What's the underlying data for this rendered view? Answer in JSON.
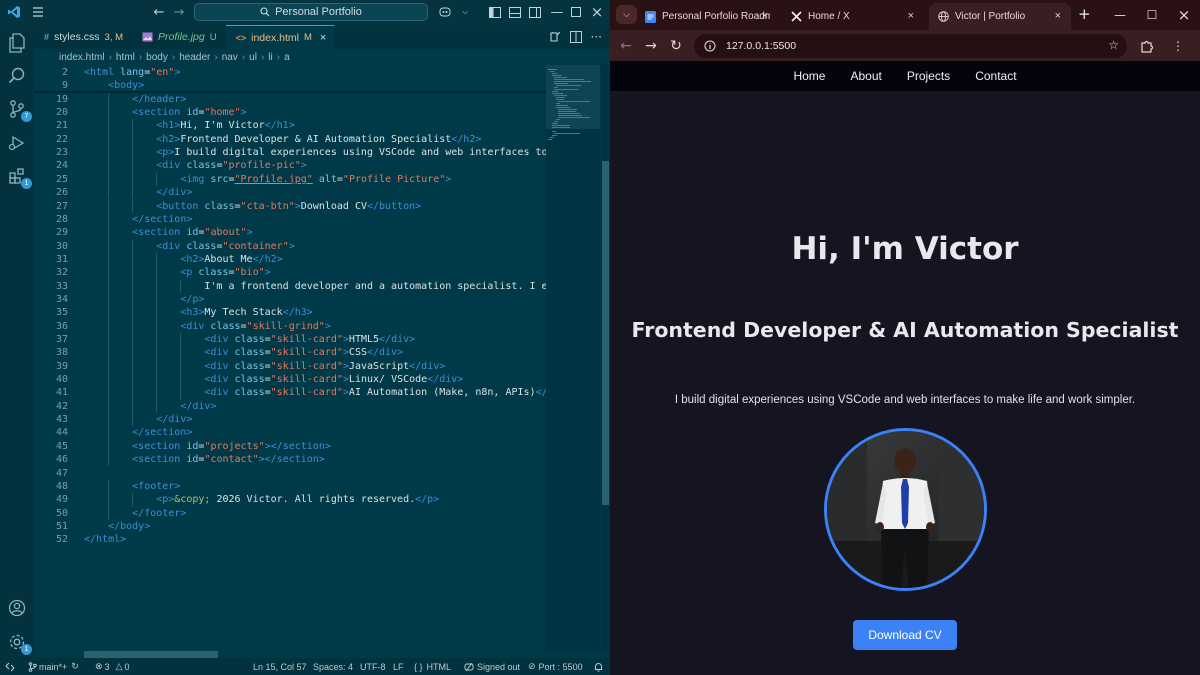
{
  "vscode": {
    "search_title": "Personal Portfolio",
    "tabs": [
      {
        "icon": "#",
        "name": "styles.css",
        "status": "3, M",
        "icon_color": "#42a5f5",
        "active": false,
        "italic": false
      },
      {
        "icon": "",
        "name": "Profile.jpg",
        "status": "U",
        "icon_color": "#a57bd1",
        "active": false,
        "italic": true
      },
      {
        "icon": "<>",
        "name": "index.html",
        "status": "M",
        "icon_color": "#e7824e",
        "active": true,
        "italic": false
      }
    ],
    "breadcrumb": [
      "index.html",
      "html",
      "body",
      "header",
      "nav",
      "ul",
      "li",
      "a"
    ],
    "activity_badges": {
      "source_control": "7",
      "extensions": "1",
      "settings": "1"
    },
    "code": [
      {
        "n": "2",
        "i": 0,
        "h": [
          [
            "t",
            "<html "
          ],
          [
            "a",
            "lang"
          ],
          [
            "x",
            "="
          ],
          [
            "s",
            "\"en\""
          ],
          [
            "t",
            ">"
          ]
        ]
      },
      {
        "n": "9",
        "i": 1,
        "h": [
          [
            "t",
            "<body>"
          ]
        ]
      },
      {
        "n": "19",
        "i": 2,
        "h": [
          [
            "t",
            "</header>"
          ]
        ]
      },
      {
        "n": "20",
        "i": 2,
        "h": [
          [
            "t",
            "<section "
          ],
          [
            "a",
            "id"
          ],
          [
            "x",
            "="
          ],
          [
            "s",
            "\"home\""
          ],
          [
            "t",
            ">"
          ]
        ]
      },
      {
        "n": "21",
        "i": 3,
        "h": [
          [
            "t",
            "<h1>"
          ],
          [
            "x",
            "Hi, I'm Victor"
          ],
          [
            "t",
            "</h1>"
          ]
        ]
      },
      {
        "n": "22",
        "i": 3,
        "h": [
          [
            "t",
            "<h2>"
          ],
          [
            "x",
            "Frontend Developer & AI Automation Specialist"
          ],
          [
            "t",
            "</h2>"
          ]
        ]
      },
      {
        "n": "23",
        "i": 3,
        "h": [
          [
            "t",
            "<p>"
          ],
          [
            "x",
            "I build digital experiences using VSCode and web interfaces to m"
          ]
        ]
      },
      {
        "n": "24",
        "i": 3,
        "h": [
          [
            "t",
            "<div "
          ],
          [
            "a",
            "class"
          ],
          [
            "x",
            "="
          ],
          [
            "s",
            "\"profile-pic\""
          ],
          [
            "t",
            ">"
          ]
        ]
      },
      {
        "n": "25",
        "i": 4,
        "h": [
          [
            "t",
            "<img "
          ],
          [
            "a",
            "src"
          ],
          [
            "x",
            "="
          ],
          [
            "s",
            "\"Profile.jpg\""
          ],
          [
            "x",
            " "
          ],
          [
            "a",
            "alt"
          ],
          [
            "x",
            "="
          ],
          [
            "s",
            "\"Profile Picture\""
          ],
          [
            "t",
            ">"
          ]
        ]
      },
      {
        "n": "26",
        "i": 3,
        "h": [
          [
            "t",
            "</div>"
          ]
        ]
      },
      {
        "n": "27",
        "i": 3,
        "h": [
          [
            "t",
            "<button "
          ],
          [
            "a",
            "class"
          ],
          [
            "x",
            "="
          ],
          [
            "s",
            "\"cta-btn\""
          ],
          [
            "t",
            ">"
          ],
          [
            "x",
            "Download CV"
          ],
          [
            "t",
            "</button>"
          ]
        ]
      },
      {
        "n": "28",
        "i": 2,
        "h": [
          [
            "t",
            "</section>"
          ]
        ]
      },
      {
        "n": "29",
        "i": 2,
        "h": [
          [
            "t",
            "<section "
          ],
          [
            "a",
            "id"
          ],
          [
            "x",
            "="
          ],
          [
            "s",
            "\"about\""
          ],
          [
            "t",
            ">"
          ]
        ]
      },
      {
        "n": "30",
        "i": 3,
        "h": [
          [
            "t",
            "<div "
          ],
          [
            "a",
            "class"
          ],
          [
            "x",
            "="
          ],
          [
            "s",
            "\"container\""
          ],
          [
            "t",
            ">"
          ]
        ]
      },
      {
        "n": "31",
        "i": 4,
        "h": [
          [
            "t",
            "<h2>"
          ],
          [
            "x",
            "About Me"
          ],
          [
            "t",
            "</h2>"
          ]
        ]
      },
      {
        "n": "32",
        "i": 4,
        "h": [
          [
            "t",
            "<p "
          ],
          [
            "a",
            "class"
          ],
          [
            "x",
            "="
          ],
          [
            "s",
            "\"bio\""
          ],
          [
            "t",
            ">"
          ]
        ]
      },
      {
        "n": "33",
        "i": 5,
        "h": [
          [
            "x",
            "I'm a frontend developer and a automation specialist. I en"
          ]
        ]
      },
      {
        "n": "34",
        "i": 4,
        "h": [
          [
            "t",
            "</p>"
          ]
        ]
      },
      {
        "n": "35",
        "i": 4,
        "h": [
          [
            "t",
            "<h3>"
          ],
          [
            "x",
            "My Tech Stack"
          ],
          [
            "t",
            "</h3>"
          ]
        ]
      },
      {
        "n": "36",
        "i": 4,
        "h": [
          [
            "t",
            "<div "
          ],
          [
            "a",
            "class"
          ],
          [
            "x",
            "="
          ],
          [
            "s",
            "\"skill-grind\""
          ],
          [
            "t",
            ">"
          ]
        ]
      },
      {
        "n": "37",
        "i": 5,
        "h": [
          [
            "t",
            "<div "
          ],
          [
            "a",
            "class"
          ],
          [
            "x",
            "="
          ],
          [
            "s",
            "\"skill-card\""
          ],
          [
            "t",
            ">"
          ],
          [
            "x",
            "HTML5"
          ],
          [
            "t",
            "</div>"
          ]
        ]
      },
      {
        "n": "38",
        "i": 5,
        "h": [
          [
            "t",
            "<div "
          ],
          [
            "a",
            "class"
          ],
          [
            "x",
            "="
          ],
          [
            "s",
            "\"skill-card\""
          ],
          [
            "t",
            ">"
          ],
          [
            "x",
            "CSS"
          ],
          [
            "t",
            "</div>"
          ]
        ]
      },
      {
        "n": "39",
        "i": 5,
        "h": [
          [
            "t",
            "<div "
          ],
          [
            "a",
            "class"
          ],
          [
            "x",
            "="
          ],
          [
            "s",
            "\"skill-card\""
          ],
          [
            "t",
            ">"
          ],
          [
            "x",
            "JavaScript"
          ],
          [
            "t",
            "</div>"
          ]
        ]
      },
      {
        "n": "40",
        "i": 5,
        "h": [
          [
            "t",
            "<div "
          ],
          [
            "a",
            "class"
          ],
          [
            "x",
            "="
          ],
          [
            "s",
            "\"skill-card\""
          ],
          [
            "t",
            ">"
          ],
          [
            "x",
            "Linux/ VSCode"
          ],
          [
            "t",
            "</div>"
          ]
        ]
      },
      {
        "n": "41",
        "i": 5,
        "h": [
          [
            "t",
            "<div "
          ],
          [
            "a",
            "class"
          ],
          [
            "x",
            "="
          ],
          [
            "s",
            "\"skill-card\""
          ],
          [
            "t",
            ">"
          ],
          [
            "x",
            "AI Automation (Make, n8n, APIs)"
          ],
          [
            "t",
            "</d"
          ]
        ]
      },
      {
        "n": "42",
        "i": 4,
        "h": [
          [
            "t",
            "</div>"
          ]
        ]
      },
      {
        "n": "43",
        "i": 3,
        "h": [
          [
            "t",
            "</div>"
          ]
        ]
      },
      {
        "n": "44",
        "i": 2,
        "h": [
          [
            "t",
            "</section>"
          ]
        ]
      },
      {
        "n": "45",
        "i": 2,
        "h": [
          [
            "t",
            "<section "
          ],
          [
            "a",
            "id"
          ],
          [
            "x",
            "="
          ],
          [
            "s",
            "\"projects\""
          ],
          [
            "t",
            "></section>"
          ]
        ]
      },
      {
        "n": "46",
        "i": 2,
        "h": [
          [
            "t",
            "<section "
          ],
          [
            "a",
            "id"
          ],
          [
            "x",
            "="
          ],
          [
            "s",
            "\"contact\""
          ],
          [
            "t",
            "></section>"
          ]
        ]
      },
      {
        "n": "47",
        "i": 0,
        "h": []
      },
      {
        "n": "48",
        "i": 2,
        "h": [
          [
            "t",
            "<footer>"
          ]
        ]
      },
      {
        "n": "49",
        "i": 3,
        "h": [
          [
            "t",
            "<p>"
          ],
          [
            "e",
            "&copy;"
          ],
          [
            "x",
            " 2026 Victor. All rights reserved."
          ],
          [
            "t",
            "</p>"
          ]
        ]
      },
      {
        "n": "50",
        "i": 2,
        "h": [
          [
            "t",
            "</footer>"
          ]
        ]
      },
      {
        "n": "51",
        "i": 1,
        "h": [
          [
            "t",
            "</body>"
          ]
        ]
      },
      {
        "n": "52",
        "i": 0,
        "h": [
          [
            "t",
            "</html>"
          ]
        ]
      }
    ],
    "status": {
      "branch": "main*+",
      "errors": "3",
      "warnings": "0",
      "position": "Ln 15, Col 57",
      "spaces": "Spaces: 4",
      "encoding": "UTF-8",
      "eol": "LF",
      "language": "HTML",
      "account": "Signed out",
      "port": "Port : 5500"
    }
  },
  "chrome": {
    "tabs": [
      {
        "title": "Personal Porfolio Roadm",
        "favicon": "docs-icon",
        "active": false
      },
      {
        "title": "Home / X",
        "favicon": "x-icon",
        "active": false
      },
      {
        "title": "Victor | Portfolio",
        "favicon": "globe-icon",
        "active": true
      }
    ],
    "url": "127.0.0.1:5500",
    "page": {
      "nav": [
        "Home",
        "About",
        "Projects",
        "Contact"
      ],
      "h1": "Hi, I'm Victor",
      "h2": "Frontend Developer & AI Automation Specialist",
      "p": "I build digital experiences using VSCode and web interfaces to make life and work simpler.",
      "button": "Download CV",
      "accent": "#3b82f6"
    }
  }
}
